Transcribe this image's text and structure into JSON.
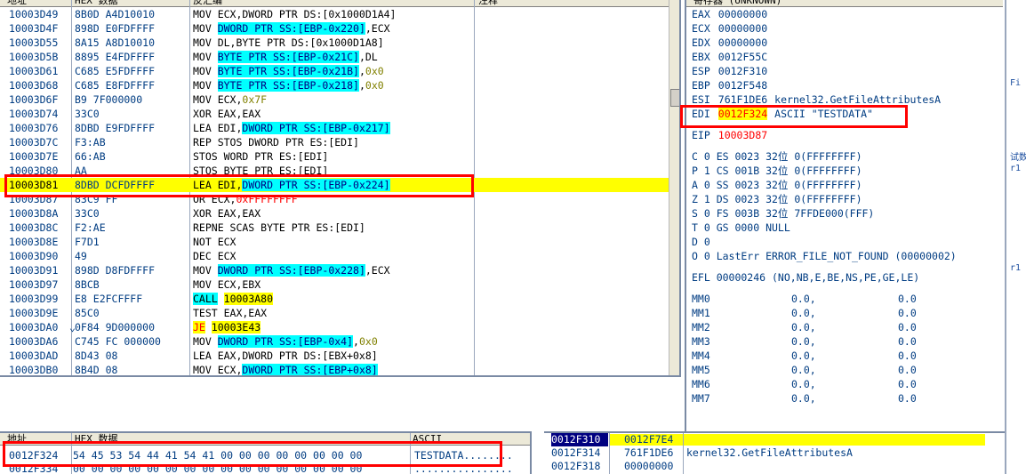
{
  "disasm": {
    "headers": [
      "地址",
      "HEX 数据",
      "反汇编",
      "注释"
    ],
    "rows": [
      {
        "addr": "10003D49",
        "hex": "8B0D A4D10010",
        "asm": [
          {
            "t": "MOV ECX,DWORD PTR DS:[0x1000D1A4]"
          }
        ]
      },
      {
        "addr": "10003D4F",
        "hex": "898D E0FDFFFF",
        "asm": [
          {
            "t": "MOV "
          },
          {
            "t": "DWORD PTR SS:[EBP-0x220]",
            "c": "hl-cyan"
          },
          {
            "t": ",ECX"
          }
        ]
      },
      {
        "addr": "10003D55",
        "hex": "8A15 A8D10010",
        "asm": [
          {
            "t": "MOV DL,BYTE PTR DS:[0x1000D1A8]"
          }
        ]
      },
      {
        "addr": "10003D5B",
        "hex": "8895 E4FDFFFF",
        "asm": [
          {
            "t": "MOV "
          },
          {
            "t": "BYTE PTR SS:[EBP-0x21C]",
            "c": "hl-cyan"
          },
          {
            "t": ",DL"
          }
        ]
      },
      {
        "addr": "10003D61",
        "hex": "C685 E5FDFFFF",
        "asm": [
          {
            "t": "MOV "
          },
          {
            "t": "BYTE PTR SS:[EBP-0x21B]",
            "c": "hl-cyan"
          },
          {
            "t": ","
          },
          {
            "t": "0x0",
            "c": "num"
          }
        ]
      },
      {
        "addr": "10003D68",
        "hex": "C685 E8FDFFFF",
        "asm": [
          {
            "t": "MOV "
          },
          {
            "t": "BYTE PTR SS:[EBP-0x218]",
            "c": "hl-cyan"
          },
          {
            "t": ","
          },
          {
            "t": "0x0",
            "c": "num"
          }
        ]
      },
      {
        "addr": "10003D6F",
        "hex": "B9 7F000000",
        "asm": [
          {
            "t": "MOV ECX,"
          },
          {
            "t": "0x7F",
            "c": "num"
          }
        ]
      },
      {
        "addr": "10003D74",
        "hex": "33C0",
        "asm": [
          {
            "t": "XOR EAX,EAX"
          }
        ]
      },
      {
        "addr": "10003D76",
        "hex": "8DBD E9FDFFFF",
        "asm": [
          {
            "t": "LEA EDI,"
          },
          {
            "t": "DWORD PTR SS:[EBP-0x217]",
            "c": "hl-cyan"
          }
        ]
      },
      {
        "addr": "10003D7C",
        "hex": "F3:AB",
        "asm": [
          {
            "t": "REP STOS DWORD PTR ES:[EDI]"
          }
        ]
      },
      {
        "addr": "10003D7E",
        "hex": "66:AB",
        "asm": [
          {
            "t": "STOS WORD PTR ES:[EDI]"
          }
        ]
      },
      {
        "addr": "10003D80",
        "hex": "AA",
        "asm": [
          {
            "t": "STOS BYTE PTR ES:[EDI]"
          }
        ]
      },
      {
        "addr": "10003D81",
        "hex": "8DBD DCFDFFFF",
        "asm": [
          {
            "t": "LEA EDI,"
          },
          {
            "t": "DWORD PTR SS:[EBP-0x224]",
            "c": "hl-cyan"
          }
        ],
        "selected": true
      },
      {
        "addr": "10003D87",
        "hex": "83C9 FF",
        "asm": [
          {
            "t": "OR ECX,"
          },
          {
            "t": "0xFFFFFFFF",
            "c": "num-red"
          }
        ]
      },
      {
        "addr": "10003D8A",
        "hex": "33C0",
        "asm": [
          {
            "t": "XOR EAX,EAX"
          }
        ]
      },
      {
        "addr": "10003D8C",
        "hex": "F2:AE",
        "asm": [
          {
            "t": "REPNE SCAS BYTE PTR ES:[EDI]"
          }
        ]
      },
      {
        "addr": "10003D8E",
        "hex": "F7D1",
        "asm": [
          {
            "t": "NOT ECX"
          }
        ]
      },
      {
        "addr": "10003D90",
        "hex": "49",
        "asm": [
          {
            "t": "DEC ECX"
          }
        ]
      },
      {
        "addr": "10003D91",
        "hex": "898D D8FDFFFF",
        "asm": [
          {
            "t": "MOV "
          },
          {
            "t": "DWORD PTR SS:[EBP-0x228]",
            "c": "hl-cyan"
          },
          {
            "t": ",ECX"
          }
        ]
      },
      {
        "addr": "10003D97",
        "hex": "8BCB",
        "asm": [
          {
            "t": "MOV ECX,EBX"
          }
        ]
      },
      {
        "addr": "10003D99",
        "hex": "E8 E2FCFFFF",
        "asm": [
          {
            "t": "CALL",
            "c": "kw-call"
          },
          {
            "t": " "
          },
          {
            "t": "10003A80",
            "c": "hl-yel"
          }
        ]
      },
      {
        "addr": "10003D9E",
        "hex": "85C0",
        "asm": [
          {
            "t": "TEST EAX,EAX"
          }
        ]
      },
      {
        "addr": "10003DA0",
        "hex": "0F84 9D000000",
        "asm": [
          {
            "t": "JE",
            "c": "kw-je"
          },
          {
            "t": " "
          },
          {
            "t": "10003E43",
            "c": "hl-yel"
          }
        ],
        "mark": "⌄"
      },
      {
        "addr": "10003DA6",
        "hex": "C745 FC 000000",
        "asm": [
          {
            "t": "MOV "
          },
          {
            "t": "DWORD PTR SS:[EBP-0x4]",
            "c": "hl-cyan"
          },
          {
            "t": ","
          },
          {
            "t": "0x0",
            "c": "num"
          }
        ]
      },
      {
        "addr": "10003DAD",
        "hex": "8D43 08",
        "asm": [
          {
            "t": "LEA EAX,DWORD PTR DS:[EBX+0x8]"
          }
        ]
      },
      {
        "addr": "10003DB0",
        "hex": "8B4D 08",
        "asm": [
          {
            "t": "MOV ECX,"
          },
          {
            "t": "DWORD PTR SS:[EBP+0x8]",
            "c": "hl-cyan"
          }
        ]
      }
    ]
  },
  "registers": {
    "title": "寄存器 (UNKNOWN)",
    "general": [
      {
        "name": "EAX",
        "value": "00000000"
      },
      {
        "name": "ECX",
        "value": "00000000"
      },
      {
        "name": "EDX",
        "value": "00000000"
      },
      {
        "name": "EBX",
        "value": "0012F55C"
      },
      {
        "name": "ESP",
        "value": "0012F310"
      },
      {
        "name": "EBP",
        "value": "0012F548"
      },
      {
        "name": "ESI",
        "value": "761F1DE6",
        "note": "kernel32.GetFileAttributesA"
      },
      {
        "name": "EDI",
        "value": "0012F324",
        "note": "ASCII \"TESTDATA\"",
        "changed": true
      }
    ],
    "eip": {
      "name": "EIP",
      "value": "10003D87"
    },
    "flags": [
      "C 0  ES 0023 32位 0(FFFFFFFF)",
      "P 1  CS 001B 32位 0(FFFFFFFF)",
      "A 0  SS 0023 32位 0(FFFFFFFF)",
      "Z 1  DS 0023 32位 0(FFFFFFFF)",
      "S 0  FS 003B 32位 7FFDE000(FFF)",
      "T 0  GS 0000 NULL",
      "D 0",
      "O 0  LastErr ERROR_FILE_NOT_FOUND (00000002)"
    ],
    "efl": "EFL 00000246 (NO,NB,E,BE,NS,PE,GE,LE)",
    "mmx": [
      {
        "name": "MM0",
        "a": "0.0,",
        "b": "0.0"
      },
      {
        "name": "MM1",
        "a": "0.0,",
        "b": "0.0"
      },
      {
        "name": "MM2",
        "a": "0.0,",
        "b": "0.0"
      },
      {
        "name": "MM3",
        "a": "0.0,",
        "b": "0.0"
      },
      {
        "name": "MM4",
        "a": "0.0,",
        "b": "0.0"
      },
      {
        "name": "MM5",
        "a": "0.0,",
        "b": "0.0"
      },
      {
        "name": "MM6",
        "a": "0.0,",
        "b": "0.0"
      },
      {
        "name": "MM7",
        "a": "0.0,",
        "b": "0.0"
      }
    ]
  },
  "dump": {
    "headers": [
      "地址",
      "HEX 数据",
      "ASCII"
    ],
    "rows": [
      {
        "addr": "0012F324",
        "hex": "54 45 53 54 44 41 54 41 00 00 00 00 00 00 00 00",
        "ascii": "TESTDATA........"
      },
      {
        "addr": "0012F334",
        "hex": "00 00 00 00 00 00 00 00 00 00 00 00 00 00 00 00",
        "ascii": "................"
      }
    ]
  },
  "stack": {
    "rows": [
      {
        "addr": "0012F310",
        "value": "0012F7E4",
        "comment": "",
        "selected": true
      },
      {
        "addr": "0012F314",
        "value": "761F1DE6",
        "comment": "kernel32.GetFileAttributesA"
      },
      {
        "addr": "0012F318",
        "value": "00000000",
        "comment": ""
      }
    ]
  },
  "side": {
    "texts": [
      "Fi",
      "试数",
      "r1",
      "r1"
    ]
  },
  "colors": {
    "text_blue": "#003c82",
    "highlight_cyan": "#00ffff",
    "highlight_yellow": "#ffff00",
    "annotation_red": "#ff0000",
    "border": "#7a8aa4"
  }
}
